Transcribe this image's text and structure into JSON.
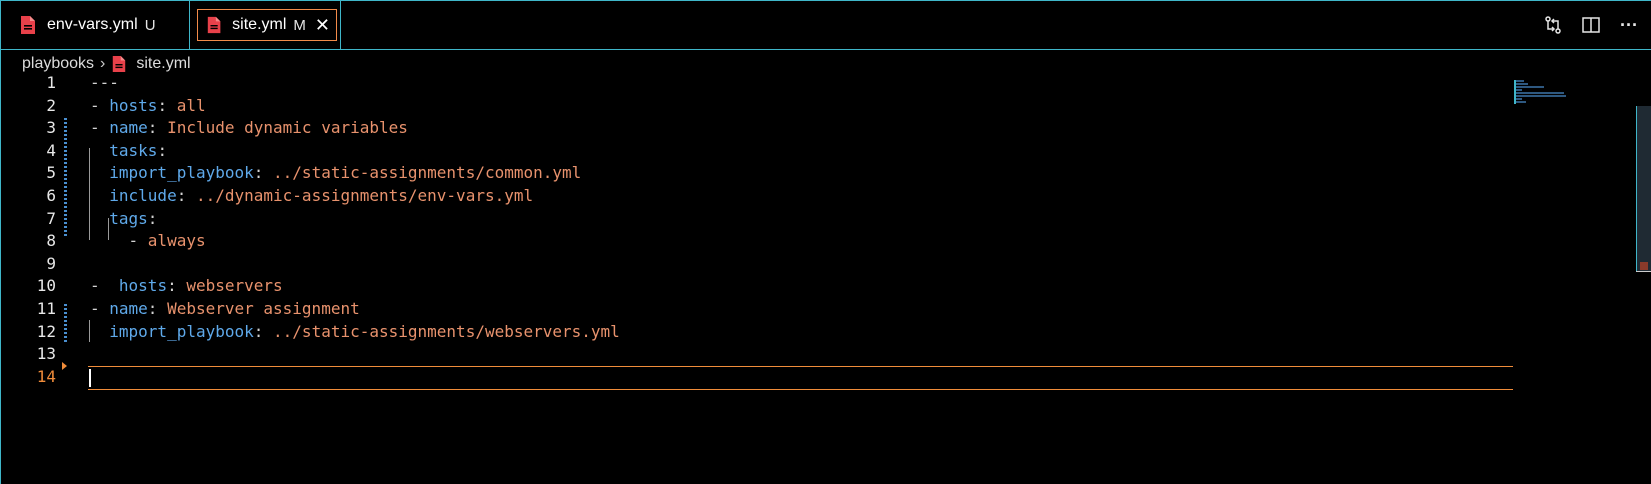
{
  "tabs": [
    {
      "label": "env-vars.yml",
      "badge": "U",
      "icon": "yaml-file-icon"
    },
    {
      "label": "site.yml",
      "badge": "M",
      "close": "✕",
      "icon": "yaml-file-icon",
      "active": true
    }
  ],
  "actions": [
    "source-control-compare-icon",
    "split-editor-icon",
    "more-actions-icon"
  ],
  "actions_more_label": "···",
  "breadcrumb": {
    "folder": "playbooks",
    "separator": "›",
    "file": "site.yml"
  },
  "editor": {
    "current_line": 14,
    "lines": [
      {
        "n": "1",
        "tokens": [
          {
            "t": "---",
            "c": "p"
          }
        ]
      },
      {
        "n": "2",
        "tokens": [
          {
            "t": "- ",
            "c": "p"
          },
          {
            "t": "hosts",
            "c": "k"
          },
          {
            "t": ": ",
            "c": "p"
          },
          {
            "t": "all",
            "c": "s"
          }
        ]
      },
      {
        "n": "3",
        "tokens": [
          {
            "t": "- ",
            "c": "p"
          },
          {
            "t": "name",
            "c": "k"
          },
          {
            "t": ": ",
            "c": "p"
          },
          {
            "t": "Include dynamic variables",
            "c": "s"
          }
        ]
      },
      {
        "n": "4",
        "tokens": [
          {
            "t": "  ",
            "c": "p"
          },
          {
            "t": "tasks",
            "c": "k"
          },
          {
            "t": ":",
            "c": "p"
          }
        ]
      },
      {
        "n": "5",
        "tokens": [
          {
            "t": "  ",
            "c": "p"
          },
          {
            "t": "import_playbook",
            "c": "k"
          },
          {
            "t": ": ",
            "c": "p"
          },
          {
            "t": "../static-assignments/common.yml",
            "c": "s"
          }
        ]
      },
      {
        "n": "6",
        "tokens": [
          {
            "t": "  ",
            "c": "p"
          },
          {
            "t": "include",
            "c": "k"
          },
          {
            "t": ": ",
            "c": "p"
          },
          {
            "t": "../dynamic-assignments/env-vars.yml",
            "c": "s"
          }
        ]
      },
      {
        "n": "7",
        "tokens": [
          {
            "t": "  ",
            "c": "p"
          },
          {
            "t": "tags",
            "c": "k"
          },
          {
            "t": ":",
            "c": "p"
          }
        ]
      },
      {
        "n": "8",
        "tokens": [
          {
            "t": "    - ",
            "c": "p"
          },
          {
            "t": "always",
            "c": "s"
          }
        ]
      },
      {
        "n": "9",
        "tokens": []
      },
      {
        "n": "10",
        "tokens": [
          {
            "t": "-  ",
            "c": "p"
          },
          {
            "t": "hosts",
            "c": "k"
          },
          {
            "t": ": ",
            "c": "p"
          },
          {
            "t": "webservers",
            "c": "s"
          }
        ]
      },
      {
        "n": "11",
        "tokens": [
          {
            "t": "- ",
            "c": "p"
          },
          {
            "t": "name",
            "c": "k"
          },
          {
            "t": ": ",
            "c": "p"
          },
          {
            "t": "Webserver assignment",
            "c": "s"
          }
        ]
      },
      {
        "n": "12",
        "tokens": [
          {
            "t": "  ",
            "c": "p"
          },
          {
            "t": "import_playbook",
            "c": "k"
          },
          {
            "t": ": ",
            "c": "p"
          },
          {
            "t": "../static-assignments/webservers.yml",
            "c": "s"
          }
        ]
      },
      {
        "n": "13",
        "tokens": []
      },
      {
        "n": "14",
        "tokens": []
      }
    ]
  },
  "colors": {
    "accent": "#3fb6c9",
    "active_tab_border": "#f38b4a",
    "keyword": "#5fa9ea",
    "string": "#e8926d",
    "line_number_active": "#f08c3a"
  }
}
